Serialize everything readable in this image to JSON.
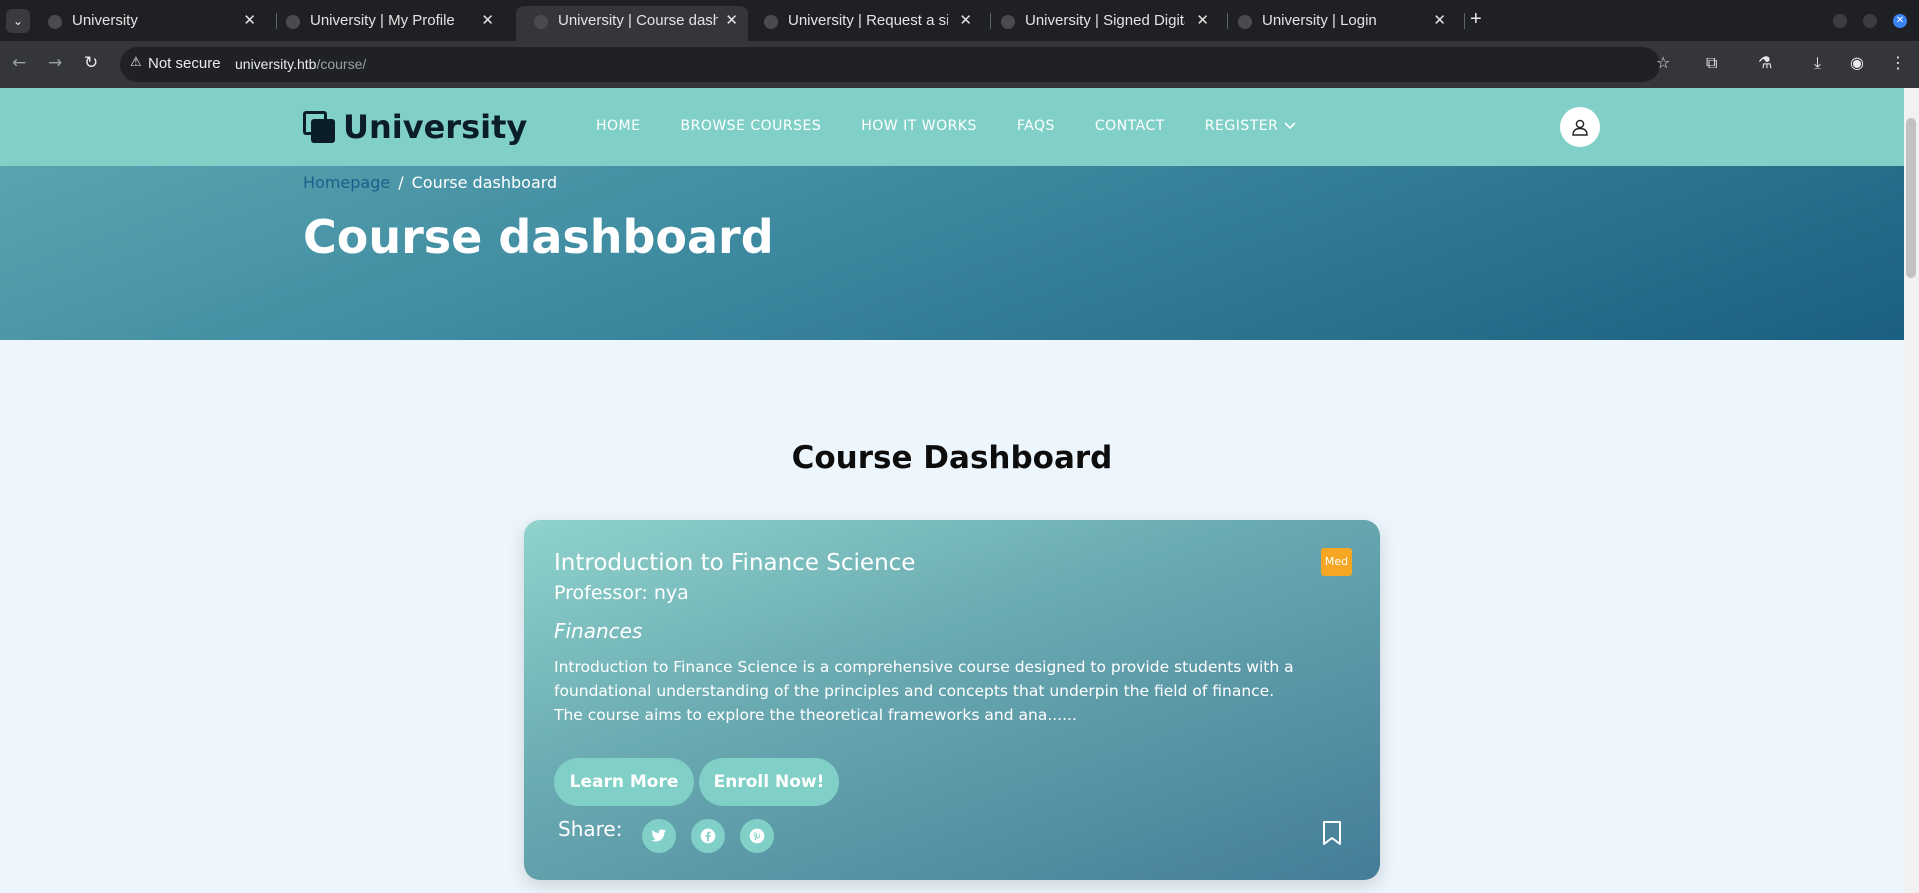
{
  "browser": {
    "tabs": [
      {
        "title": "University",
        "active": false
      },
      {
        "title": "University | My Profile",
        "active": false
      },
      {
        "title": "University | Course dashb",
        "active": true
      },
      {
        "title": "University | Request a sig",
        "active": false
      },
      {
        "title": "University | Signed Digita",
        "active": false
      },
      {
        "title": "University | Login",
        "active": false
      }
    ],
    "security_label": "Not secure",
    "url_host": "university.htb",
    "url_path": "/course/"
  },
  "site": {
    "logo_text": "University",
    "nav": [
      "HOME",
      "BROWSE COURSES",
      "HOW IT WORKS",
      "FAQS",
      "CONTACT",
      "REGISTER"
    ],
    "breadcrumb": {
      "home": "Homepage",
      "separator": "/",
      "current": "Course dashboard"
    },
    "hero_title": "Course dashboard",
    "section_title": "Course Dashboard"
  },
  "course": {
    "title": "Introduction to Finance Science",
    "professor": "Professor: nya",
    "category": "Finances",
    "level_badge": "Med",
    "description": "Introduction to Finance Science is a comprehensive course designed to provide students with a foundational understanding of the principles and concepts that underpin the field of finance. The course aims to explore the theoretical frameworks and ana......",
    "learn_more_label": "Learn More",
    "enroll_label": "Enroll Now!",
    "share_label": "Share:",
    "share_icons": [
      "twitter-icon",
      "facebook-icon",
      "pinterest-icon"
    ]
  },
  "colors": {
    "header_bg": "#80d0c7",
    "badge": "#f5a623",
    "button": "#80d0c7",
    "breadcrumb_link": "#1c5f8a"
  }
}
